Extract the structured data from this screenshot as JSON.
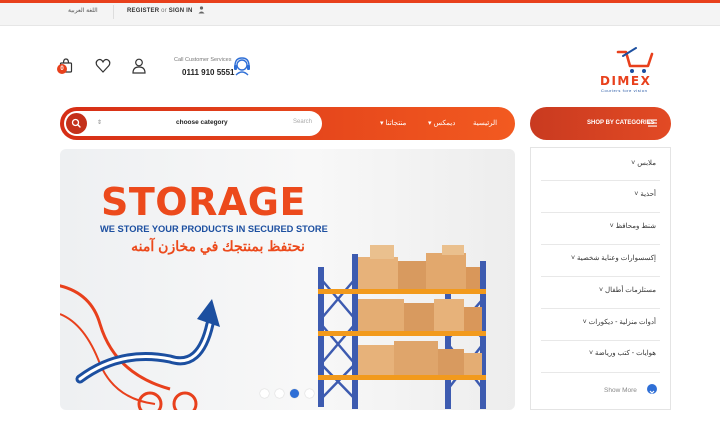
{
  "topbar": {
    "language": "اللغة العربية",
    "register": "REGISTER",
    "or": "or",
    "signin": "SIGN IN"
  },
  "brand": {
    "name": "DIMEX",
    "tagline": "Couriers fore vision",
    "accent": "#e8401c",
    "secondary": "#1c4fa0"
  },
  "header": {
    "customer_service_label": "Call Customer Services",
    "phone": "0111 910 5551",
    "cart_count": "0"
  },
  "nav": {
    "search_placeholder": "Search",
    "category_chooser": "choose category",
    "links": [
      "الرئيسية",
      "ديمكس",
      "منتجاتنا"
    ],
    "shop_by_categories": "SHOP BY CATEGORIES"
  },
  "categories": {
    "items": [
      "ملابس",
      "أحذية",
      "شنط ومحافظ",
      "إكسسوارات وعناية شخصية",
      "مستلزمات أطفال",
      "أدوات منزلية - ديكورات",
      "هوايات - كتب ورياضة"
    ],
    "show_more": "Show More"
  },
  "banner": {
    "title": "STORAGE",
    "subtitle": "WE STORE YOUR PRODUCTS IN SECURED STORE",
    "arabic": "نحتفظ بمنتجك في مخازن آمنه",
    "slides": 4,
    "active_slide": 3
  }
}
